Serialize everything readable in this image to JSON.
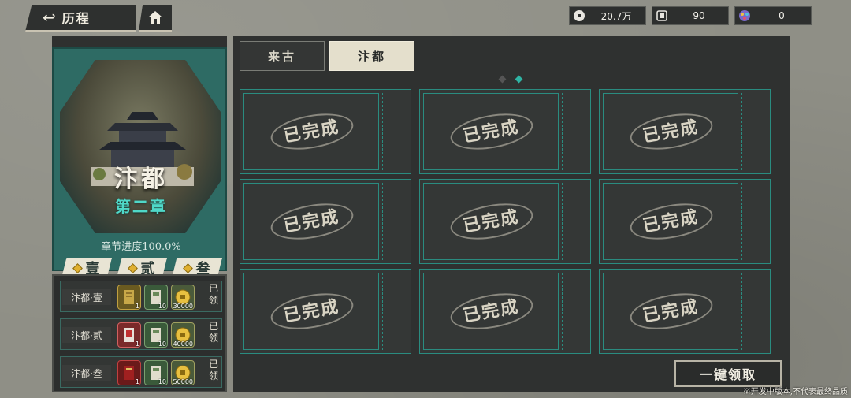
{
  "header": {
    "back_label": "历程",
    "resources": [
      {
        "icon": "coin-icon",
        "value": "20.7万"
      },
      {
        "icon": "scroll-token-icon",
        "value": "90"
      },
      {
        "icon": "gem-icon",
        "value": "0"
      }
    ]
  },
  "chapter": {
    "name": "汴都",
    "subtitle": "第二章",
    "progress": "章节进度100.0%",
    "stages": [
      "壹",
      "贰",
      "叁"
    ]
  },
  "rewards": [
    {
      "name": "汴都·壹",
      "items": [
        {
          "icon": "scroll-icon",
          "qty": "1"
        },
        {
          "icon": "book-icon",
          "qty": "10"
        },
        {
          "icon": "gold-coin-icon",
          "qty": "30000"
        }
      ],
      "status": "已领"
    },
    {
      "name": "汴都·贰",
      "items": [
        {
          "icon": "red-card-icon",
          "qty": "1"
        },
        {
          "icon": "book-icon",
          "qty": "10"
        },
        {
          "icon": "gold-coin-icon",
          "qty": "40000"
        }
      ],
      "status": "已领"
    },
    {
      "name": "汴都·叁",
      "items": [
        {
          "icon": "red-scroll-icon",
          "qty": "1"
        },
        {
          "icon": "book-icon",
          "qty": "10"
        },
        {
          "icon": "gold-coin-icon",
          "qty": "50000"
        }
      ],
      "status": "已领"
    }
  ],
  "tabs": [
    {
      "label": "来古",
      "active": false
    },
    {
      "label": "汴都",
      "active": true
    }
  ],
  "tickets": [
    "已完成",
    "已完成",
    "已完成",
    "已完成",
    "已完成",
    "已完成",
    "已完成",
    "已完成",
    "已完成"
  ],
  "claim_all_label": "一键领取",
  "dev_note": "※开发中版本,不代表最终品质",
  "colors": {
    "accent_teal": "#2e6b64",
    "teal_text": "#4fd8c8",
    "gold": "#e0b030"
  }
}
